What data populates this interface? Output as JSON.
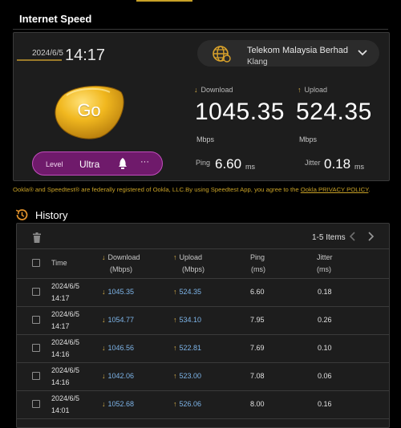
{
  "section_title": "Internet Speed",
  "result": {
    "date": "2024/6/5",
    "time": "14:17",
    "download_label": "Download",
    "upload_label": "Upload",
    "download": "1045.35",
    "upload": "524.35",
    "download_unit": "Mbps",
    "upload_unit": "Mbps",
    "ping_label": "Ping",
    "ping": "6.60",
    "ping_unit": "ms",
    "jitter_label": "Jitter",
    "jitter": "0.18",
    "jitter_unit": "ms"
  },
  "isp": {
    "name": "Telekom Malaysia Berhad",
    "city": "Klang"
  },
  "go_label": "Go",
  "level": {
    "label": "Level",
    "value": "Ultra",
    "more": "···"
  },
  "legal": {
    "text": "Ookla® and Speedtest® are federally registered of Ookla, LLC.By using Speedtest App, you agree to the ",
    "link": "Ookla PRIVACY POLICY",
    "end": "."
  },
  "history": {
    "title": "History",
    "items_label": "1-5 Items",
    "columns": {
      "time": "Time",
      "download": "Download",
      "download_unit": "(Mbps)",
      "upload": "Upload",
      "upload_unit": "(Mbps)",
      "ping": "Ping",
      "ping_unit": "(ms)",
      "jitter": "Jitter",
      "jitter_unit": "(ms)"
    },
    "rows": [
      {
        "date": "2024/6/5",
        "time": "14:17",
        "download": "1045.35",
        "upload": "524.35",
        "ping": "6.60",
        "jitter": "0.18"
      },
      {
        "date": "2024/6/5",
        "time": "14:17",
        "download": "1054.77",
        "upload": "534.10",
        "ping": "7.95",
        "jitter": "0.26"
      },
      {
        "date": "2024/6/5",
        "time": "14:16",
        "download": "1046.56",
        "upload": "522.81",
        "ping": "7.69",
        "jitter": "0.10"
      },
      {
        "date": "2024/6/5",
        "time": "14:16",
        "download": "1042.06",
        "upload": "523.00",
        "ping": "7.08",
        "jitter": "0.06"
      },
      {
        "date": "2024/6/5",
        "time": "14:01",
        "download": "1052.68",
        "upload": "526.06",
        "ping": "8.00",
        "jitter": "0.16"
      }
    ]
  },
  "colors": {
    "accent_gold": "#c9a227",
    "level_purple": "#6f1a6b",
    "value_blue": "#7db4e8"
  },
  "icons": {
    "isp": "globe-icon",
    "bell": "rocket-bell-icon",
    "history": "history-icon",
    "trash": "trash-icon"
  }
}
